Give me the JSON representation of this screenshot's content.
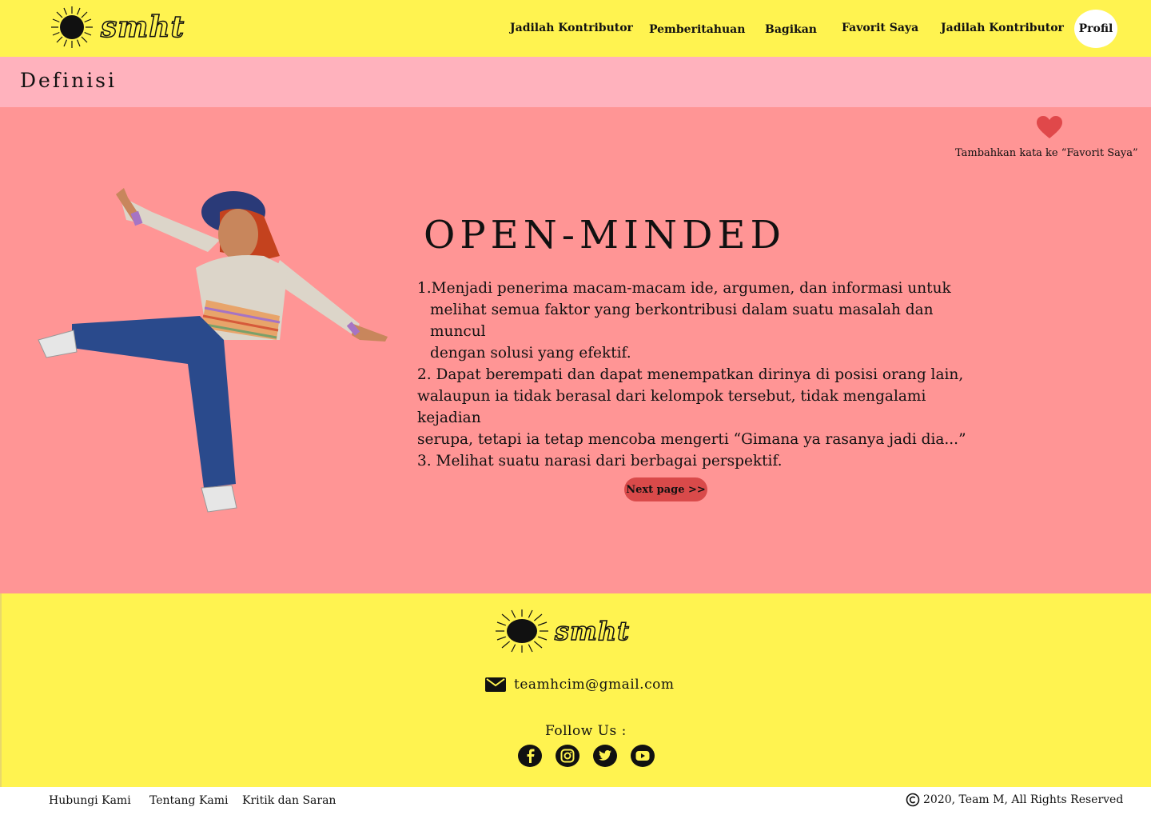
{
  "header": {
    "logo_text": "smht",
    "nav": [
      "Jadilah Kontributor",
      "Pemberitahuan",
      "Bagikan",
      "Favorit Saya",
      "Jadilah Kontributor"
    ],
    "profile_label": "Profil"
  },
  "subheader": {
    "title": "Definisi"
  },
  "main": {
    "favorite_text": "Tambahkan kata ke “Favorit Saya”",
    "word": "OPEN-MINDED",
    "definitions": [
      "1.Menjadi penerima macam-macam ide, argumen, dan informasi untuk",
      "melihat semua faktor yang berkontribusi dalam suatu masalah dan muncul",
      "dengan solusi yang efektif.",
      "2. Dapat berempati dan dapat menempatkan dirinya di posisi orang lain,",
      "walaupun ia tidak berasal dari kelompok tersebut, tidak mengalami kejadian",
      "serupa, tetapi ia tetap mencoba mengerti “Gimana ya rasanya jadi dia...”",
      "3. Melihat suatu narasi dari berbagai perspektif."
    ],
    "next_button": "Next page >>"
  },
  "footer": {
    "logo_text": "smht",
    "email": "teamhcim@gmail.com",
    "follow_label": "Follow Us :",
    "socials": [
      "facebook-icon",
      "instagram-icon",
      "twitter-icon",
      "youtube-icon"
    ],
    "links": [
      "Hubungi Kami",
      "Tentang Kami",
      "Kritik dan Saran"
    ],
    "copyright": "2020, Team M, All Rights Reserved"
  },
  "colors": {
    "yellow": "#fff350",
    "pink_light": "#ffb2bd",
    "pink_main": "#ff9595",
    "red_accent": "#d94a4a"
  }
}
